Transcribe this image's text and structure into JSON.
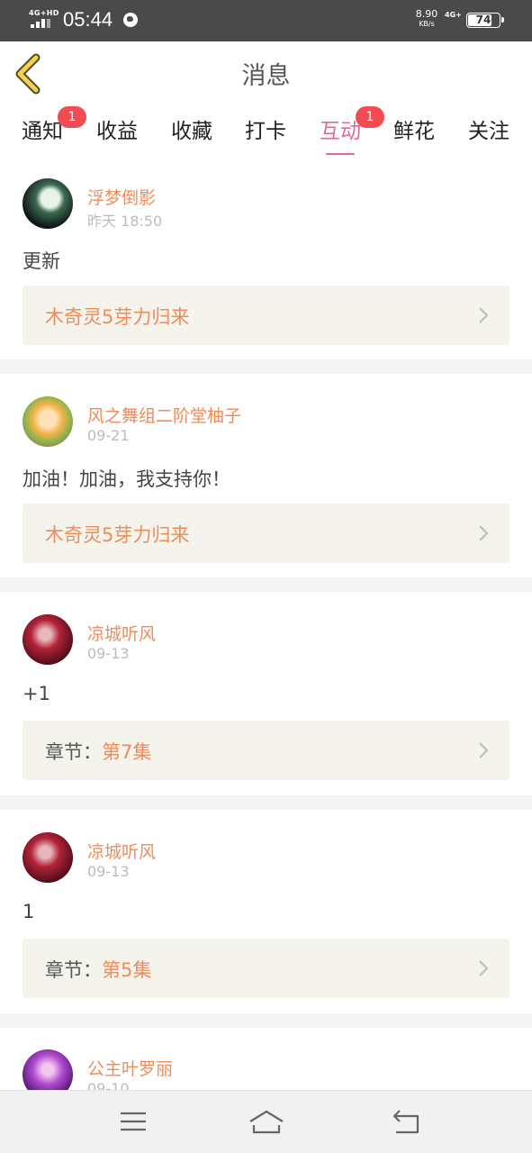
{
  "status_bar": {
    "network_left": "4G+HD",
    "time": "05:44",
    "speed_value": "8.90",
    "speed_unit": "KB/s",
    "network_right": "4G+",
    "battery": "74"
  },
  "header": {
    "title": "消息",
    "accent_color": "#e0689c"
  },
  "tabs": [
    {
      "label": "通知",
      "badge": "1",
      "active": false
    },
    {
      "label": "收益",
      "badge": "",
      "active": false
    },
    {
      "label": "收藏",
      "badge": "",
      "active": false
    },
    {
      "label": "打卡",
      "badge": "",
      "active": false
    },
    {
      "label": "互动",
      "badge": "1",
      "active": true
    },
    {
      "label": "鲜花",
      "badge": "",
      "active": false
    },
    {
      "label": "关注",
      "badge": "",
      "active": false
    }
  ],
  "messages": [
    {
      "user": "浮梦倒影",
      "date": "昨天 18:50",
      "content": "更新",
      "link_prefix": "",
      "link_text": "木奇灵5芽力归来"
    },
    {
      "user": "风之舞组二阶堂柚子",
      "date": "09-21",
      "content": "加油！加油，我支持你！",
      "link_prefix": "",
      "link_text": "木奇灵5芽力归来"
    },
    {
      "user": "凉城听风",
      "date": "09-13",
      "content": "+1",
      "link_prefix": "章节：",
      "link_text": "第7集"
    },
    {
      "user": "凉城听风",
      "date": "09-13",
      "content": "1",
      "link_prefix": "章节：",
      "link_text": "第5集"
    },
    {
      "user": "公主叶罗丽",
      "date": "09-10",
      "content": "",
      "link_prefix": "",
      "link_text": ""
    }
  ],
  "colors": {
    "username": "#f08b5a",
    "badge": "#f24b52",
    "link_box_bg": "#f4f4ec"
  },
  "icons": {
    "back": "chevron-left-icon",
    "link_arrow": "chevron-right-icon",
    "nav_menu": "menu-icon",
    "nav_home": "home-icon",
    "nav_back": "return-icon"
  }
}
